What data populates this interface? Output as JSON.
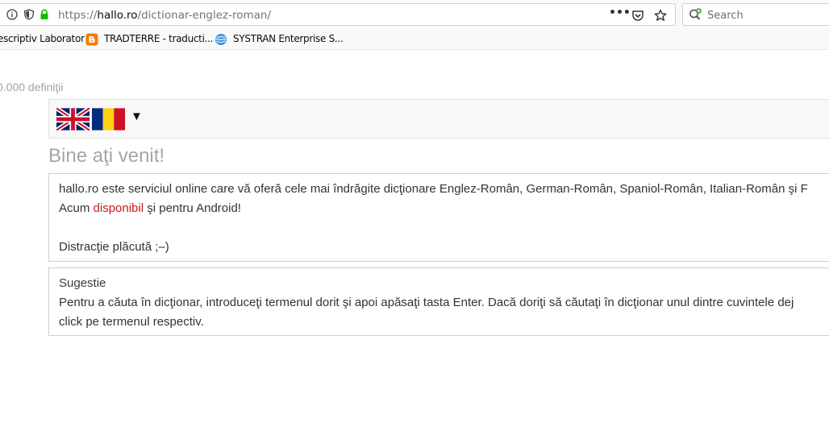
{
  "browser": {
    "url_prefix": "https://",
    "url_domain": "hallo.ro",
    "url_path": "/dictionar-englez-roman/",
    "more_label": "•••",
    "search_placeholder": "Search",
    "bookmarks": [
      {
        "label": "escriptiv Laborator",
        "icon": "none"
      },
      {
        "label": "TRADTERRE - traducti...",
        "icon": "blogger-icon"
      },
      {
        "label": "SYSTRAN Enterprise S...",
        "icon": "systran-icon"
      }
    ]
  },
  "page": {
    "definitions_count": "0.000 definiţii",
    "language_dropdown_arrow": "▼",
    "flags": [
      "uk-flag-icon",
      "romania-flag-icon"
    ],
    "welcome_title": "Bine aţi venit!",
    "intro": {
      "line1": "hallo.ro este serviciul online care vă oferă cele mai îndrăgite dicţionare Englez-Român, German-Român, Spaniol-Român, Italian-Român şi F",
      "line2_prefix": "Acum ",
      "line2_link": "disponibil",
      "line2_suffix": " şi pentru Android!",
      "line3": "Distracţie plăcută ;–)"
    },
    "suggestion": {
      "title": "Sugestie",
      "line1": "Pentru a căuta în dicţionar, introduceţi termenul dorit şi apoi apăsaţi tasta Enter. Dacă doriţi să căutaţi în dicţionar unul dintre cuvintele dej",
      "line2": "click pe termenul respectiv."
    }
  },
  "colors": {
    "link": "#c41919",
    "muted": "#a6a6a6",
    "secure_lock": "#12bc00"
  }
}
